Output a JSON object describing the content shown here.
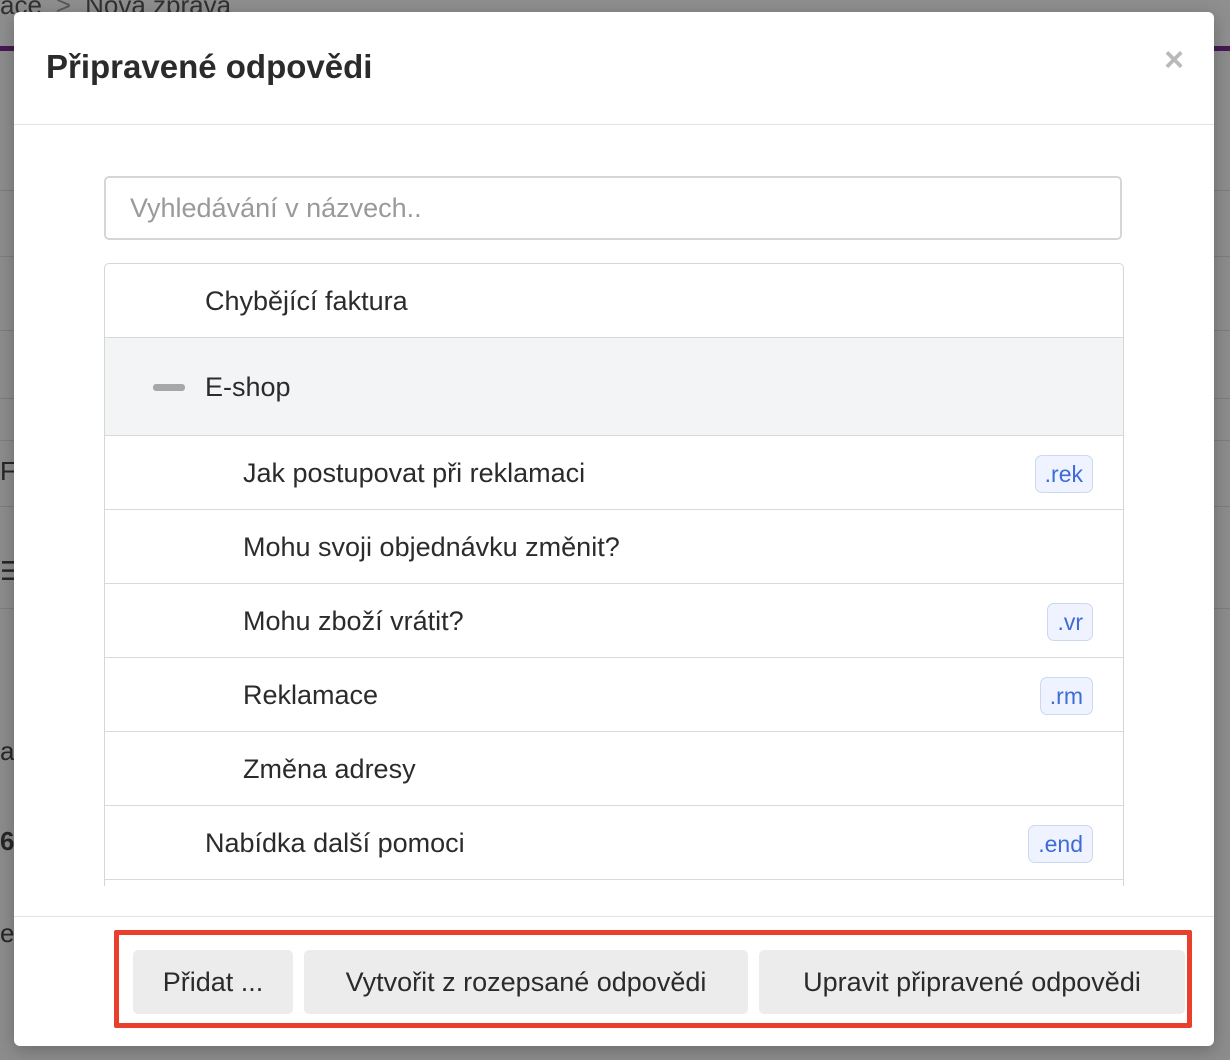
{
  "background": {
    "breadcrumb": [
      "ace",
      "Nová zpráva"
    ],
    "fragments": [
      "F",
      "☰",
      "a",
      "6",
      "ev"
    ]
  },
  "modal": {
    "title": "Připravené odpovědi",
    "close_symbol": "×",
    "search_placeholder": "Vyhledávání v názvech..",
    "items": [
      {
        "label": "Chybějící faktura",
        "shortcut": ""
      },
      {
        "label": "E-shop",
        "group": true,
        "expanded": true
      },
      {
        "label": "Jak postupovat při reklamaci",
        "shortcut": ".rek"
      },
      {
        "label": "Mohu svoji objednávku změnit?",
        "shortcut": ""
      },
      {
        "label": "Mohu zboží vrátit?",
        "shortcut": ".vr"
      },
      {
        "label": "Reklamace",
        "shortcut": ".rm"
      },
      {
        "label": "Změna adresy",
        "shortcut": ""
      },
      {
        "label": "Nabídka další pomoci",
        "shortcut": ".end"
      }
    ],
    "footer": {
      "add_label": "Přidat ...",
      "create_label": "Vytvořit z rozepsané odpovědi",
      "edit_label": "Upravit připravené odpovědi"
    }
  },
  "colors": {
    "highlight": "#e8402c",
    "shortcut_text": "#3f6bd7",
    "accent_bar": "#7b2a92"
  }
}
